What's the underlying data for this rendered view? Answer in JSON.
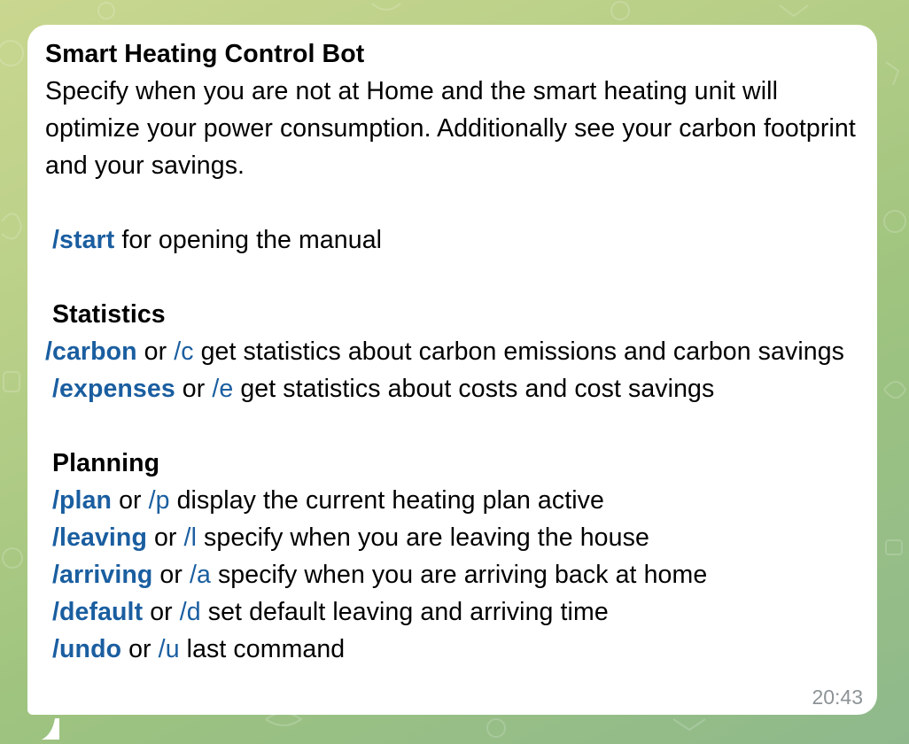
{
  "message": {
    "title": "Smart Heating Control Bot",
    "intro": " Specify when you are not at Home and the smart heating unit will optimize your power consumption. Additionally see your carbon footprint and your savings.",
    "start_line": {
      "command": "/start",
      "description": " for opening the manual"
    },
    "statistics": {
      "heading": "Statistics",
      "commands": [
        {
          "command": "/carbon",
          "or": " or ",
          "alias": "/c",
          "description": " get statistics about carbon emissions and carbon savings"
        },
        {
          "command": "/expenses",
          "or": " or ",
          "alias": "/e",
          "description": " get statistics about costs and cost savings"
        }
      ]
    },
    "planning": {
      "heading": "Planning",
      "commands": [
        {
          "command": "/plan",
          "or": " or ",
          "alias": "/p",
          "description": " display the current heating plan active"
        },
        {
          "command": "/leaving",
          "or": " or ",
          "alias": "/l",
          "description": " specify when you are leaving the house"
        },
        {
          "command": "/arriving",
          "or": " or ",
          "alias": "/a",
          "description": " specify when you are arriving back at home"
        },
        {
          "command": "/default",
          "or": " or ",
          "alias": "/d",
          "description": " set default leaving and arriving time"
        },
        {
          "command": "/undo",
          "or": " or ",
          "alias": "/u",
          "description": " last command"
        }
      ]
    },
    "timestamp": "20:43"
  },
  "colors": {
    "command_link": "#1a5ea0",
    "bubble_background": "#ffffff",
    "timestamp": "#8d9396"
  }
}
